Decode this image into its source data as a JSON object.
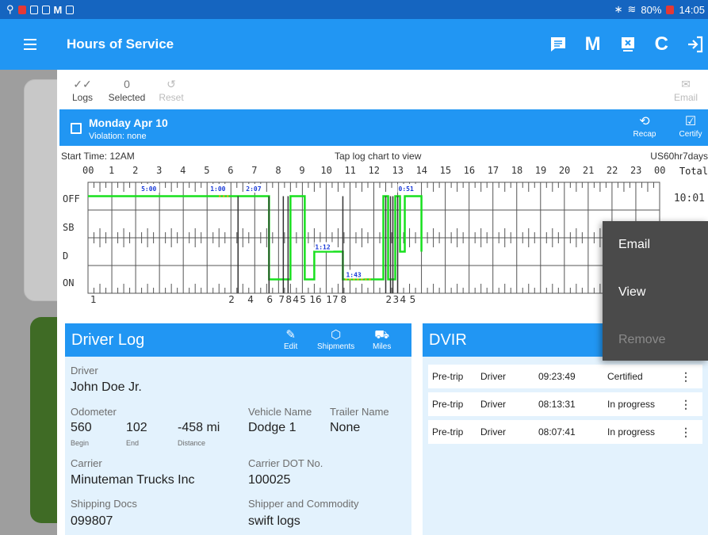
{
  "status_bar": {
    "battery": "80%",
    "time": "14:05"
  },
  "app_bar": {
    "title": "Hours of Service",
    "icons": [
      "menu-icon",
      "message-icon",
      "m-icon",
      "desktop-icon",
      "refresh-icon",
      "logout-icon"
    ],
    "m_label": "M",
    "refresh_label": "C"
  },
  "toolbar": {
    "logs_label": "Logs",
    "selected_count": "0",
    "selected_label": "Selected",
    "reset_label": "Reset",
    "email_label": "Email"
  },
  "log_header": {
    "date": "Monday Apr 10",
    "violation": "Violation: none",
    "recap_label": "Recap",
    "certify_label": "Certify"
  },
  "chart": {
    "start_time": "Start Time: 12AM",
    "tap_hint": "Tap log chart to view",
    "ruleset": "US60hr7days",
    "total_label": "Total",
    "total_value": "10:01",
    "hours": [
      "00",
      "1",
      "2",
      "3",
      "4",
      "5",
      "6",
      "7",
      "8",
      "9",
      "10",
      "11",
      "12",
      "13",
      "14",
      "15",
      "16",
      "17",
      "18",
      "19",
      "20",
      "21",
      "22",
      "23",
      "00"
    ],
    "rows": [
      "OFF",
      "SB",
      "D",
      "ON"
    ],
    "duration_labels": [
      "5:00",
      "1:00",
      "2:07",
      "0:51",
      "1:12",
      "1:43"
    ],
    "bottom_labels": [
      "1",
      "2",
      "4",
      "6",
      "7",
      "8",
      "4",
      "5",
      "16",
      "17",
      "8",
      "2",
      "3",
      "4",
      "5"
    ]
  },
  "chart_data": {
    "type": "line",
    "title": "",
    "xlabel": "",
    "ylabel": "",
    "categories": [
      "OFF",
      "SB",
      "D",
      "ON"
    ],
    "xlim": [
      0,
      24
    ],
    "series": [
      {
        "name": "",
        "points": [
          [
            0,
            "OFF"
          ],
          [
            7.6,
            "OFF"
          ],
          [
            7.6,
            "ON"
          ],
          [
            8.5,
            "ON"
          ],
          [
            8.5,
            "OFF"
          ],
          [
            9.1,
            "OFF"
          ],
          [
            9.1,
            "ON"
          ],
          [
            9.5,
            "ON"
          ],
          [
            9.5,
            "D"
          ],
          [
            10.7,
            "D"
          ],
          [
            10.7,
            "ON"
          ],
          [
            12.4,
            "ON"
          ],
          [
            12.4,
            "OFF"
          ],
          [
            12.6,
            "OFF"
          ],
          [
            12.6,
            "ON"
          ],
          [
            12.9,
            "ON"
          ],
          [
            12.9,
            "OFF"
          ],
          [
            13.1,
            "OFF"
          ],
          [
            13.1,
            "D"
          ],
          [
            13.3,
            "D"
          ],
          [
            13.3,
            "OFF"
          ],
          [
            14.0,
            "OFF"
          ],
          [
            14.0,
            "D"
          ]
        ]
      }
    ]
  },
  "popup_menu": {
    "items": [
      "Email",
      "View",
      "Remove"
    ]
  },
  "driver_log": {
    "title": "Driver Log",
    "edit_label": "Edit",
    "shipments_label": "Shipments",
    "miles_label": "Miles",
    "driver_label": "Driver",
    "driver_value": "John Doe Jr.",
    "odometer_label": "Odometer",
    "odo_begin": "560",
    "odo_end": "102",
    "odo_distance": "-458 mi",
    "begin_label": "Begin",
    "end_label": "End",
    "distance_label": "Distance",
    "vehicle_label": "Vehicle Name",
    "vehicle_value": "Dodge 1",
    "trailer_label": "Trailer Name",
    "trailer_value": "None",
    "carrier_label": "Carrier",
    "carrier_value": "Minuteman Trucks Inc",
    "dot_label": "Carrier DOT No.",
    "dot_value": "100025",
    "shipping_label": "Shipping Docs",
    "shipping_value": "099807",
    "commodity_label": "Shipper and Commodity",
    "commodity_value": "swift logs"
  },
  "dvir": {
    "title": "DVIR",
    "rows": [
      {
        "type": "Pre-trip",
        "role": "Driver",
        "time": "09:23:49",
        "status": "Certified"
      },
      {
        "type": "Pre-trip",
        "role": "Driver",
        "time": "08:13:31",
        "status": "In progress"
      },
      {
        "type": "Pre-trip",
        "role": "Driver",
        "time": "08:07:41",
        "status": "In progress"
      }
    ]
  }
}
